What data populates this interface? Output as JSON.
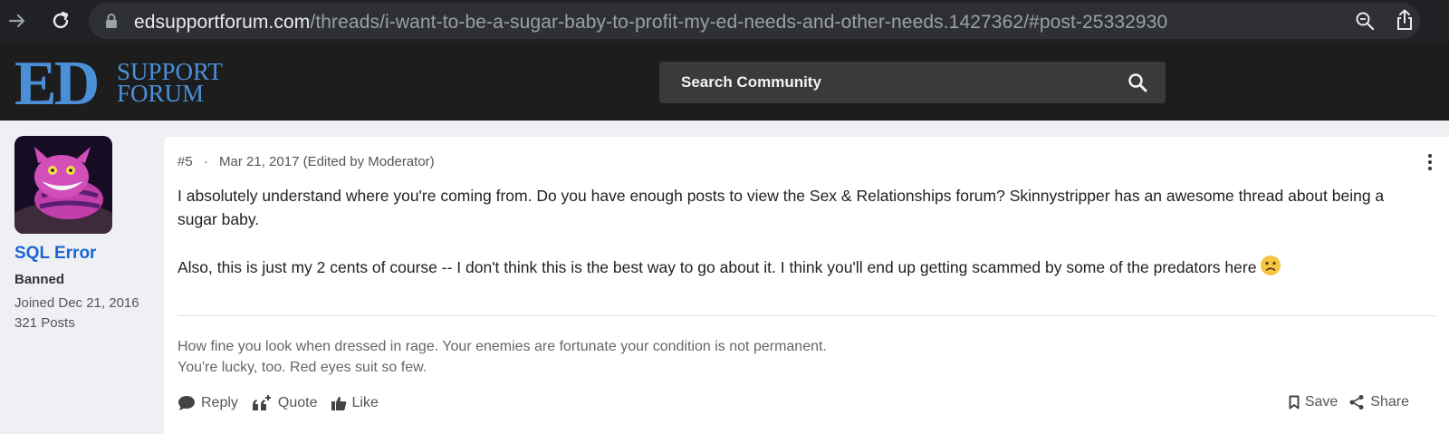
{
  "browser": {
    "url_host": "edsupportforum.com",
    "url_path": "/threads/i-want-to-be-a-sugar-baby-to-profit-my-ed-needs-and-other-needs.1427362/#post-25332930"
  },
  "header": {
    "logo_big": "ED",
    "logo_line1": "SUPPORT",
    "logo_line2": "FORUM",
    "search_placeholder": "Search Community"
  },
  "user": {
    "name": "SQL Error",
    "title": "Banned",
    "joined": "Joined Dec 21, 2016",
    "posts": "321 Posts"
  },
  "post": {
    "number": "#5",
    "separator": "·",
    "date": "Mar 21, 2017 (Edited by Moderator)",
    "paragraph1": "I absolutely understand where you're coming from. Do you have enough posts to view the Sex & Relationships forum? Skinnystripper has an awesome thread about being a sugar baby.",
    "paragraph2": "Also, this is just my 2 cents of course -- I don't think this is the best way to go about it. I think you'll end up getting scammed by some of the predators here",
    "signature_line1": "How fine you look when dressed in rage. Your enemies are fortunate your condition is not permanent.",
    "signature_line2": "You're lucky, too. Red eyes suit so few."
  },
  "actions": {
    "reply": "Reply",
    "quote": "Quote",
    "like": "Like",
    "save": "Save",
    "share": "Share"
  },
  "colors": {
    "accent_blue": "#1a67d2",
    "logo_blue": "#4a90d9",
    "header_bg": "#1d1d1d"
  }
}
